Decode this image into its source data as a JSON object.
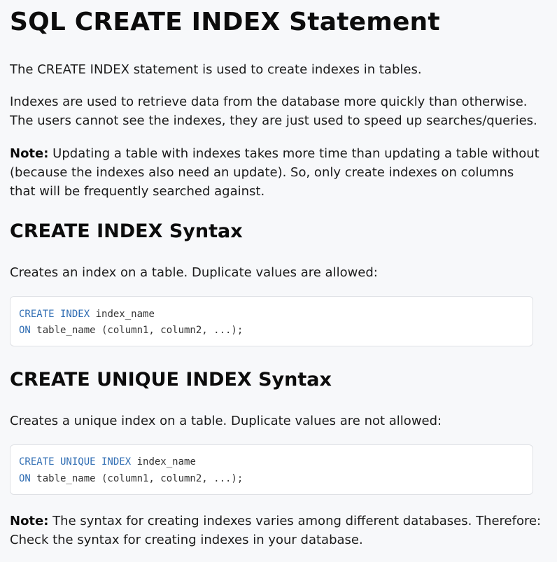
{
  "title": "SQL CREATE INDEX Statement",
  "intro": "The CREATE INDEX statement is used to create indexes in tables.",
  "para2": "Indexes are used to retrieve data from the database more quickly than otherwise. The users cannot see the indexes, they are just used to speed up searches/queries.",
  "note1": {
    "label": "Note:",
    "text": " Updating a table with indexes takes more time than updating a table without (because the indexes also need an update). So, only create indexes on columns that will be frequently searched against."
  },
  "section1": {
    "heading": "CREATE INDEX Syntax",
    "desc": "Creates an index on a table. Duplicate values are allowed:",
    "code": {
      "kw1": "CREATE INDEX",
      "rest1": " index_name",
      "kw2": "ON",
      "rest2": " table_name (column1, column2, ...);"
    }
  },
  "section2": {
    "heading": "CREATE UNIQUE INDEX Syntax",
    "desc": "Creates a unique index on a table. Duplicate values are not allowed:",
    "code": {
      "kw1": "CREATE UNIQUE INDEX",
      "rest1": " index_name",
      "kw2": "ON",
      "rest2": " table_name (column1, column2, ...);"
    }
  },
  "note2": {
    "label": "Note:",
    "text": " The syntax for creating indexes varies among different databases. Therefore: Check the syntax for creating indexes in your database."
  },
  "colors": {
    "background": "#f7f8fa",
    "code_keyword": "#2f6db3",
    "code_border": "#dfe1e5"
  }
}
